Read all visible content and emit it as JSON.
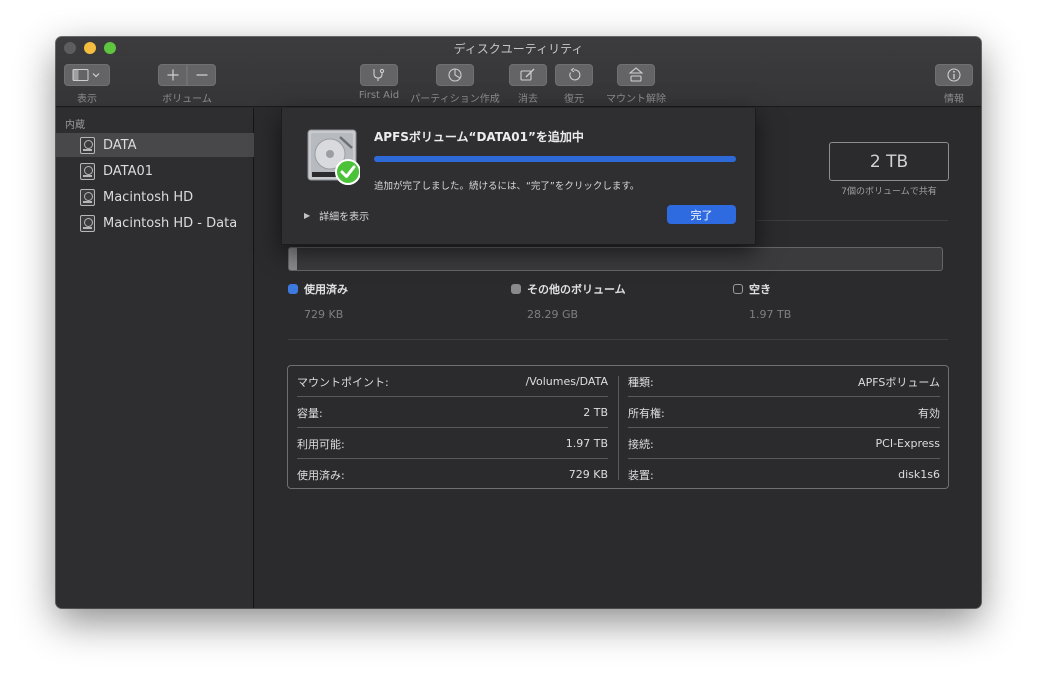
{
  "window": {
    "title": "ディスクユーティリティ"
  },
  "toolbar": {
    "view_label": "表示",
    "volume_label": "ボリューム",
    "first_aid_label": "First Aid",
    "partition_label": "パーティション作成",
    "erase_label": "消去",
    "restore_label": "復元",
    "unmount_label": "マウント解除",
    "info_label": "情報"
  },
  "sidebar": {
    "section_title": "内蔵",
    "items": [
      {
        "label": "DATA",
        "selected": true
      },
      {
        "label": "DATA01",
        "selected": false
      },
      {
        "label": "Macintosh HD",
        "selected": false
      },
      {
        "label": "Macintosh HD - Data",
        "selected": false
      }
    ]
  },
  "capacity": {
    "value": "2 TB",
    "shared_note": "7個のボリュームで共有"
  },
  "usage": {
    "used_fraction": 0.012,
    "legend": [
      {
        "label": "使用済み",
        "value": "729 KB",
        "color": "#3d7ae0",
        "filled": true
      },
      {
        "label": "その他のボリューム",
        "value": "28.29 GB",
        "color": "#8a8a8d",
        "filled": true
      },
      {
        "label": "空き",
        "value": "1.97 TB",
        "color": "#2b2b2d",
        "filled": false
      }
    ]
  },
  "info": {
    "left": [
      {
        "label": "マウントポイント:",
        "value": "/Volumes/DATA"
      },
      {
        "label": "容量:",
        "value": "2 TB"
      },
      {
        "label": "利用可能:",
        "value": "1.97 TB"
      },
      {
        "label": "使用済み:",
        "value": "729 KB"
      }
    ],
    "right": [
      {
        "label": "種類:",
        "value": "APFSボリューム"
      },
      {
        "label": "所有権:",
        "value": "有効"
      },
      {
        "label": "接続:",
        "value": "PCI-Express"
      },
      {
        "label": "装置:",
        "value": "disk1s6"
      }
    ]
  },
  "sheet": {
    "title": "APFSボリューム“DATA01”を追加中",
    "progress": 1.0,
    "message": "追加が完了しました。続けるには、“完了”をクリックします。",
    "details_label": "詳細を表示",
    "done_label": "完了"
  },
  "colors": {
    "accent": "#2f6be0",
    "progress": "#2d6ad8",
    "check": "#4cc13a"
  }
}
